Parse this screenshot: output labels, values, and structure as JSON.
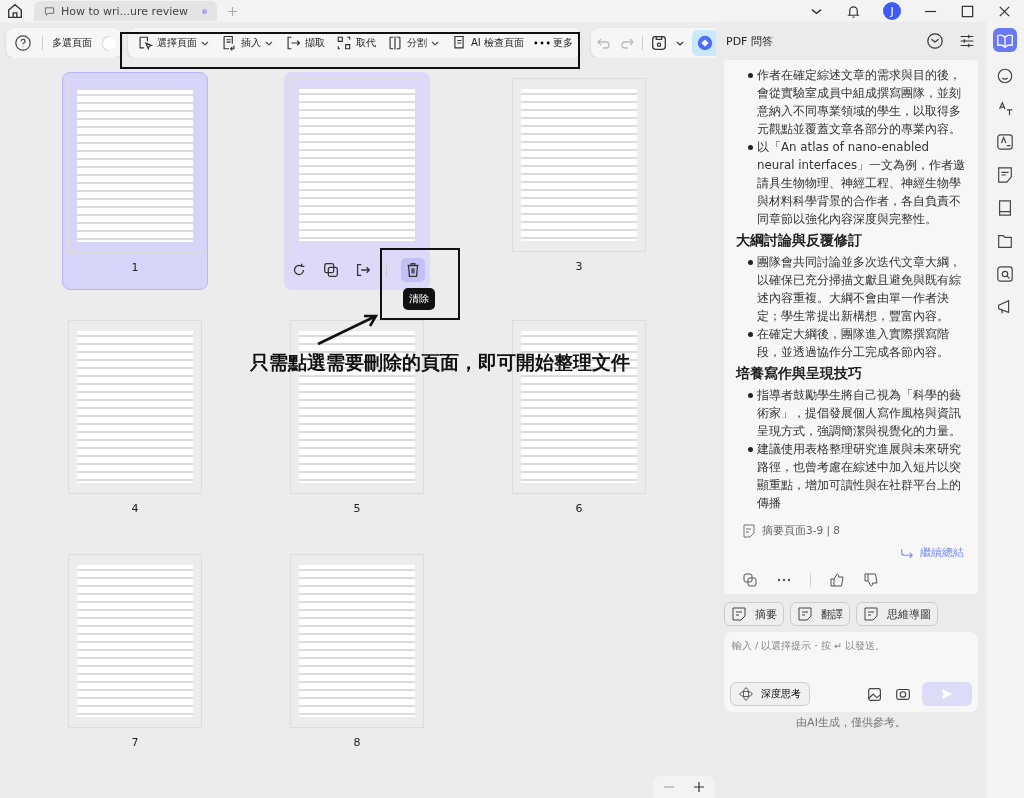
{
  "tabs": [
    {
      "title": "How to wri...ure review",
      "selected": true
    }
  ],
  "account": {
    "initial": "J"
  },
  "toolbar": {
    "multi_select": {
      "label": "多選頁面",
      "on": false
    },
    "items": [
      {
        "label": "選擇頁面",
        "dropdown": true
      },
      {
        "label": "插入",
        "dropdown": true
      },
      {
        "label": "擷取",
        "dropdown": false
      },
      {
        "label": "取代",
        "dropdown": false
      },
      {
        "label": "分割",
        "dropdown": true
      },
      {
        "label": "AI 檢查頁面",
        "dropdown": false
      },
      {
        "label": "更多",
        "dropdown": false
      }
    ]
  },
  "pages": [
    {
      "number": "1",
      "selected": true,
      "hovered": false
    },
    {
      "selected": false,
      "hovered": true
    },
    {
      "number": "3",
      "selected": false,
      "hovered": false
    },
    {
      "number": "4",
      "selected": false,
      "hovered": false
    },
    {
      "number": "5",
      "selected": false,
      "hovered": false
    },
    {
      "number": "6",
      "selected": false,
      "hovered": false
    },
    {
      "number": "7",
      "selected": false,
      "hovered": false
    },
    {
      "number": "8",
      "selected": false,
      "hovered": false
    }
  ],
  "page_actions": {
    "tooltip": "清除"
  },
  "annotation": {
    "caption": "只需點選需要刪除的頁面，即可開始整理文件"
  },
  "panel": {
    "title": "PDF 問答",
    "blocks": [
      {
        "kind": "bullet",
        "text": "作者在確定綜述文章的需求與目的後，會從實驗室成員中組成撰寫團隊，並刻意納入不同專業領域的學生，以取得多元觀點並覆蓋文章各部分的專業內容。"
      },
      {
        "kind": "bullet",
        "text": "以「An atlas of nano-enabled neural interfaces」一文為例，作者邀請具生物物理、神經工程、神經生物學與材料科學背景的合作者，各自負責不同章節以強化內容深度與完整性。"
      },
      {
        "kind": "heading",
        "text": "大綱討論與反覆修訂"
      },
      {
        "kind": "bullet",
        "text": "團隊會共同討論並多次迭代文章大綱，以確保已充分掃描文獻且避免與既有綜述內容重複。大綱不會由單一作者決定；學生常提出新構想，豐富內容。"
      },
      {
        "kind": "bullet",
        "text": "在確定大綱後，團隊進入實際撰寫階段，並透過協作分工完成各節內容。"
      },
      {
        "kind": "heading",
        "text": "培養寫作與呈現技巧"
      },
      {
        "kind": "bullet",
        "text": "指導者鼓勵學生將自己視為「科學的藝術家」，提倡發展個人寫作風格與資訊呈現方式，強調簡潔與視覺化的力量。"
      },
      {
        "kind": "bullet",
        "text": "建議使用表格整理研究進展與未來研究路徑，也曾考慮在綜述中加入短片以突顯重點，增加可讀性與在社群平台上的傳播"
      }
    ],
    "source": "摘要頁面3-9 | 8",
    "continue": "繼續總結",
    "quick_actions": [
      "摘要",
      "翻譯",
      "思維導圖"
    ],
    "input": {
      "placeholder": "輸入 / 以選擇提示・按 ↵ 以發送。"
    },
    "deep_think": "深度思考",
    "disclaimer": "由AI生成，僅供參考。"
  }
}
